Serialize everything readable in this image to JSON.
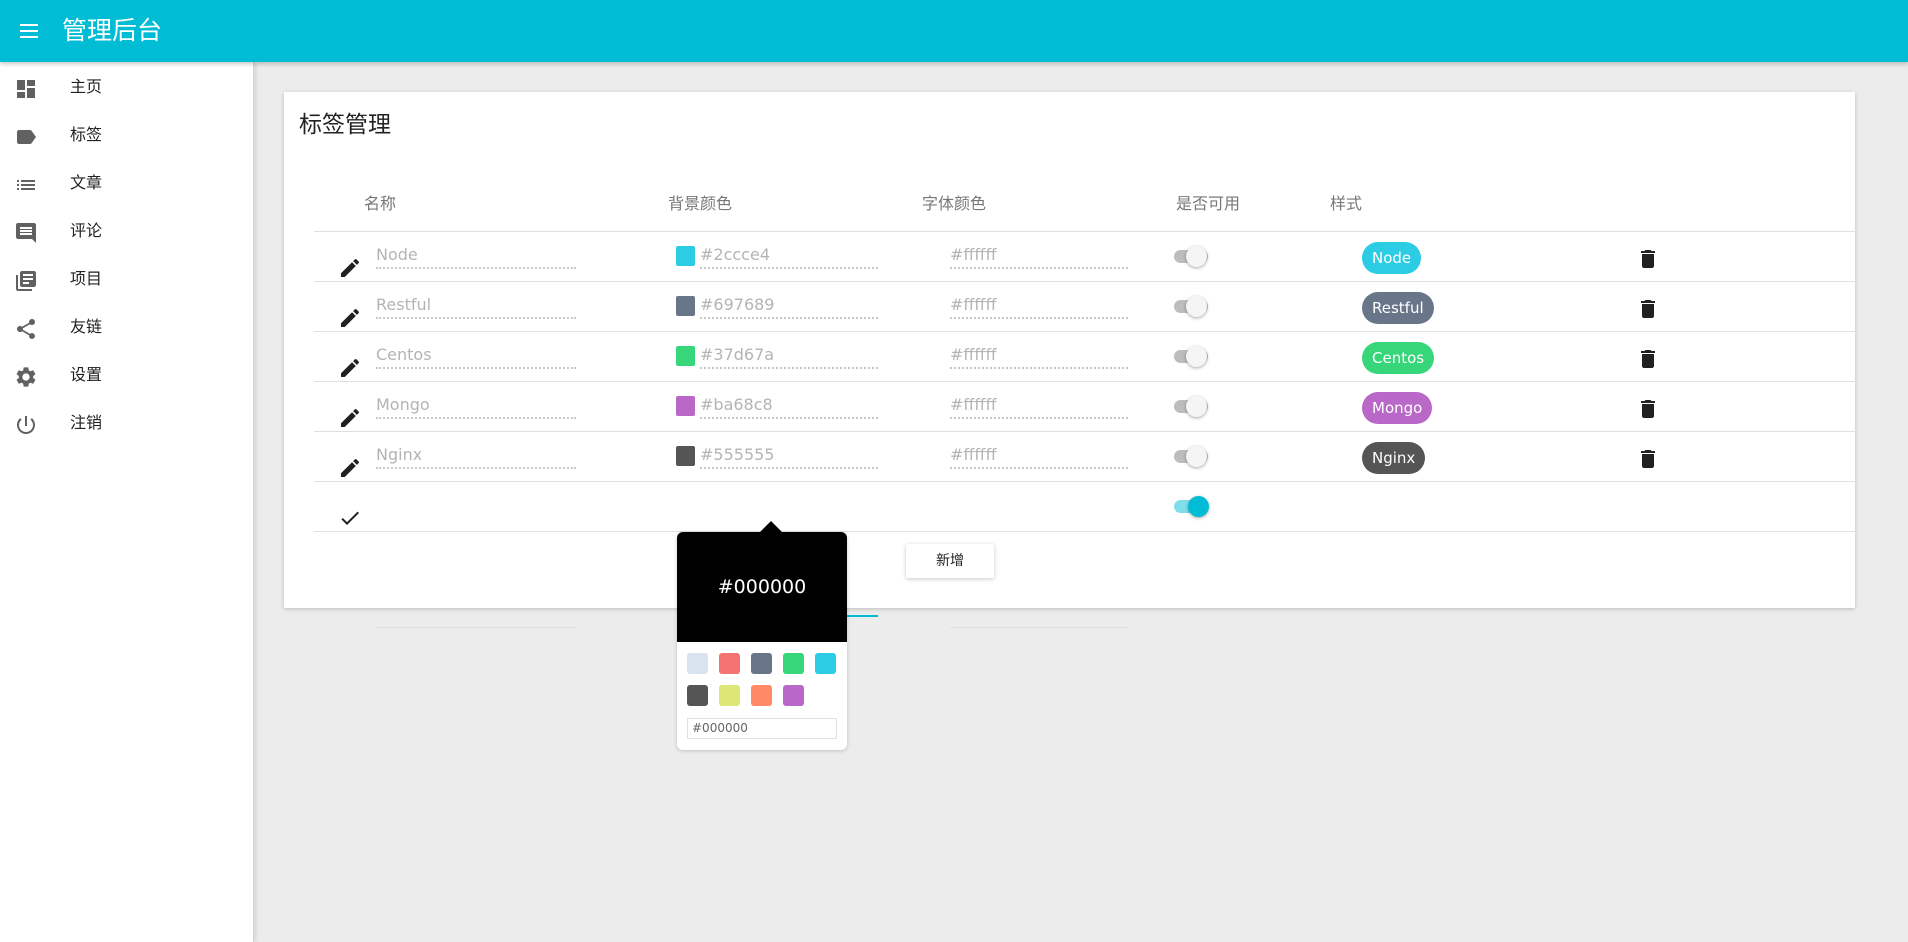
{
  "header": {
    "title": "管理后台",
    "menu_icon": "menu-icon",
    "color": "#00bcd4"
  },
  "sidebar": {
    "items": [
      {
        "label": "主页",
        "icon": "dashboard-icon"
      },
      {
        "label": "标签",
        "icon": "label-icon"
      },
      {
        "label": "文章",
        "icon": "list-icon"
      },
      {
        "label": "评论",
        "icon": "comment-icon"
      },
      {
        "label": "项目",
        "icon": "library-books-icon"
      },
      {
        "label": "友链",
        "icon": "share-icon"
      },
      {
        "label": "设置",
        "icon": "settings-icon"
      },
      {
        "label": "注销",
        "icon": "power-icon"
      }
    ]
  },
  "main": {
    "title": "标签管理",
    "columns": [
      "名称",
      "背景颜色",
      "字体颜色",
      "是否可用",
      "样式"
    ],
    "tags": [
      {
        "name": "Node",
        "bg": "#2ccce4",
        "fg": "#ffffff",
        "enabled": false,
        "label": "Node"
      },
      {
        "name": "Restful",
        "bg": "#697689",
        "fg": "#ffffff",
        "enabled": false,
        "label": "Restful"
      },
      {
        "name": "Centos",
        "bg": "#37d67a",
        "fg": "#ffffff",
        "enabled": false,
        "label": "Centos"
      },
      {
        "name": "Mongo",
        "bg": "#ba68c8",
        "fg": "#ffffff",
        "enabled": false,
        "label": "Mongo"
      },
      {
        "name": "Nginx",
        "bg": "#555555",
        "fg": "#ffffff",
        "enabled": false,
        "label": "Nginx"
      }
    ],
    "new_row": {
      "name": "",
      "bg": "",
      "fg": "",
      "enabled": true,
      "confirm_icon": "check-icon"
    },
    "add_button": "新增"
  },
  "color_picker": {
    "value": "#000000",
    "input_value": "#000000",
    "swatches": [
      "#d9e3f0",
      "#f47373",
      "#697689",
      "#37d67a",
      "#2ccce4",
      "#555555",
      "#dce775",
      "#ff8a65",
      "#ba68c8"
    ]
  }
}
